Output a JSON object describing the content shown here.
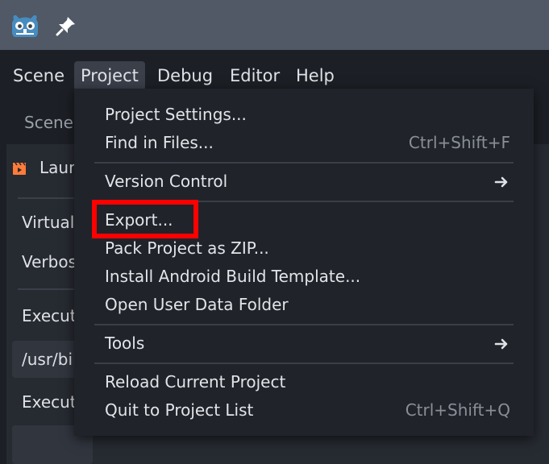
{
  "menubar": {
    "items": [
      {
        "label": "Scene"
      },
      {
        "label": "Project"
      },
      {
        "label": "Debug"
      },
      {
        "label": "Editor"
      },
      {
        "label": "Help"
      }
    ],
    "active": "Project"
  },
  "background": {
    "scene_tab": "Scene",
    "launch_label": "Laun",
    "virtual_label": "Virtual",
    "verbose_label": "Verbos",
    "executable_label_1": "Execut",
    "path_value": "/usr/bi",
    "executable_label_2": "Execut"
  },
  "project_menu": {
    "items": [
      {
        "label": "Project Settings...",
        "shortcut": ""
      },
      {
        "label": "Find in Files...",
        "shortcut": "Ctrl+Shift+F"
      },
      {
        "label": "Version Control",
        "submenu": true
      },
      {
        "label": "Export...",
        "highlighted": true
      },
      {
        "label": "Pack Project as ZIP..."
      },
      {
        "label": "Install Android Build Template..."
      },
      {
        "label": "Open User Data Folder"
      },
      {
        "label": "Tools",
        "submenu": true
      },
      {
        "label": "Reload Current Project"
      },
      {
        "label": "Quit to Project List",
        "shortcut": "Ctrl+Shift+Q"
      }
    ]
  },
  "icons": {
    "app": "godot-logo-icon",
    "pin": "pin-icon",
    "launch": "clapperboard-icon",
    "submenu": "chevron-right-icon"
  },
  "colors": {
    "highlight_box": "#ff0000",
    "godot_blue": "#478cbf"
  }
}
